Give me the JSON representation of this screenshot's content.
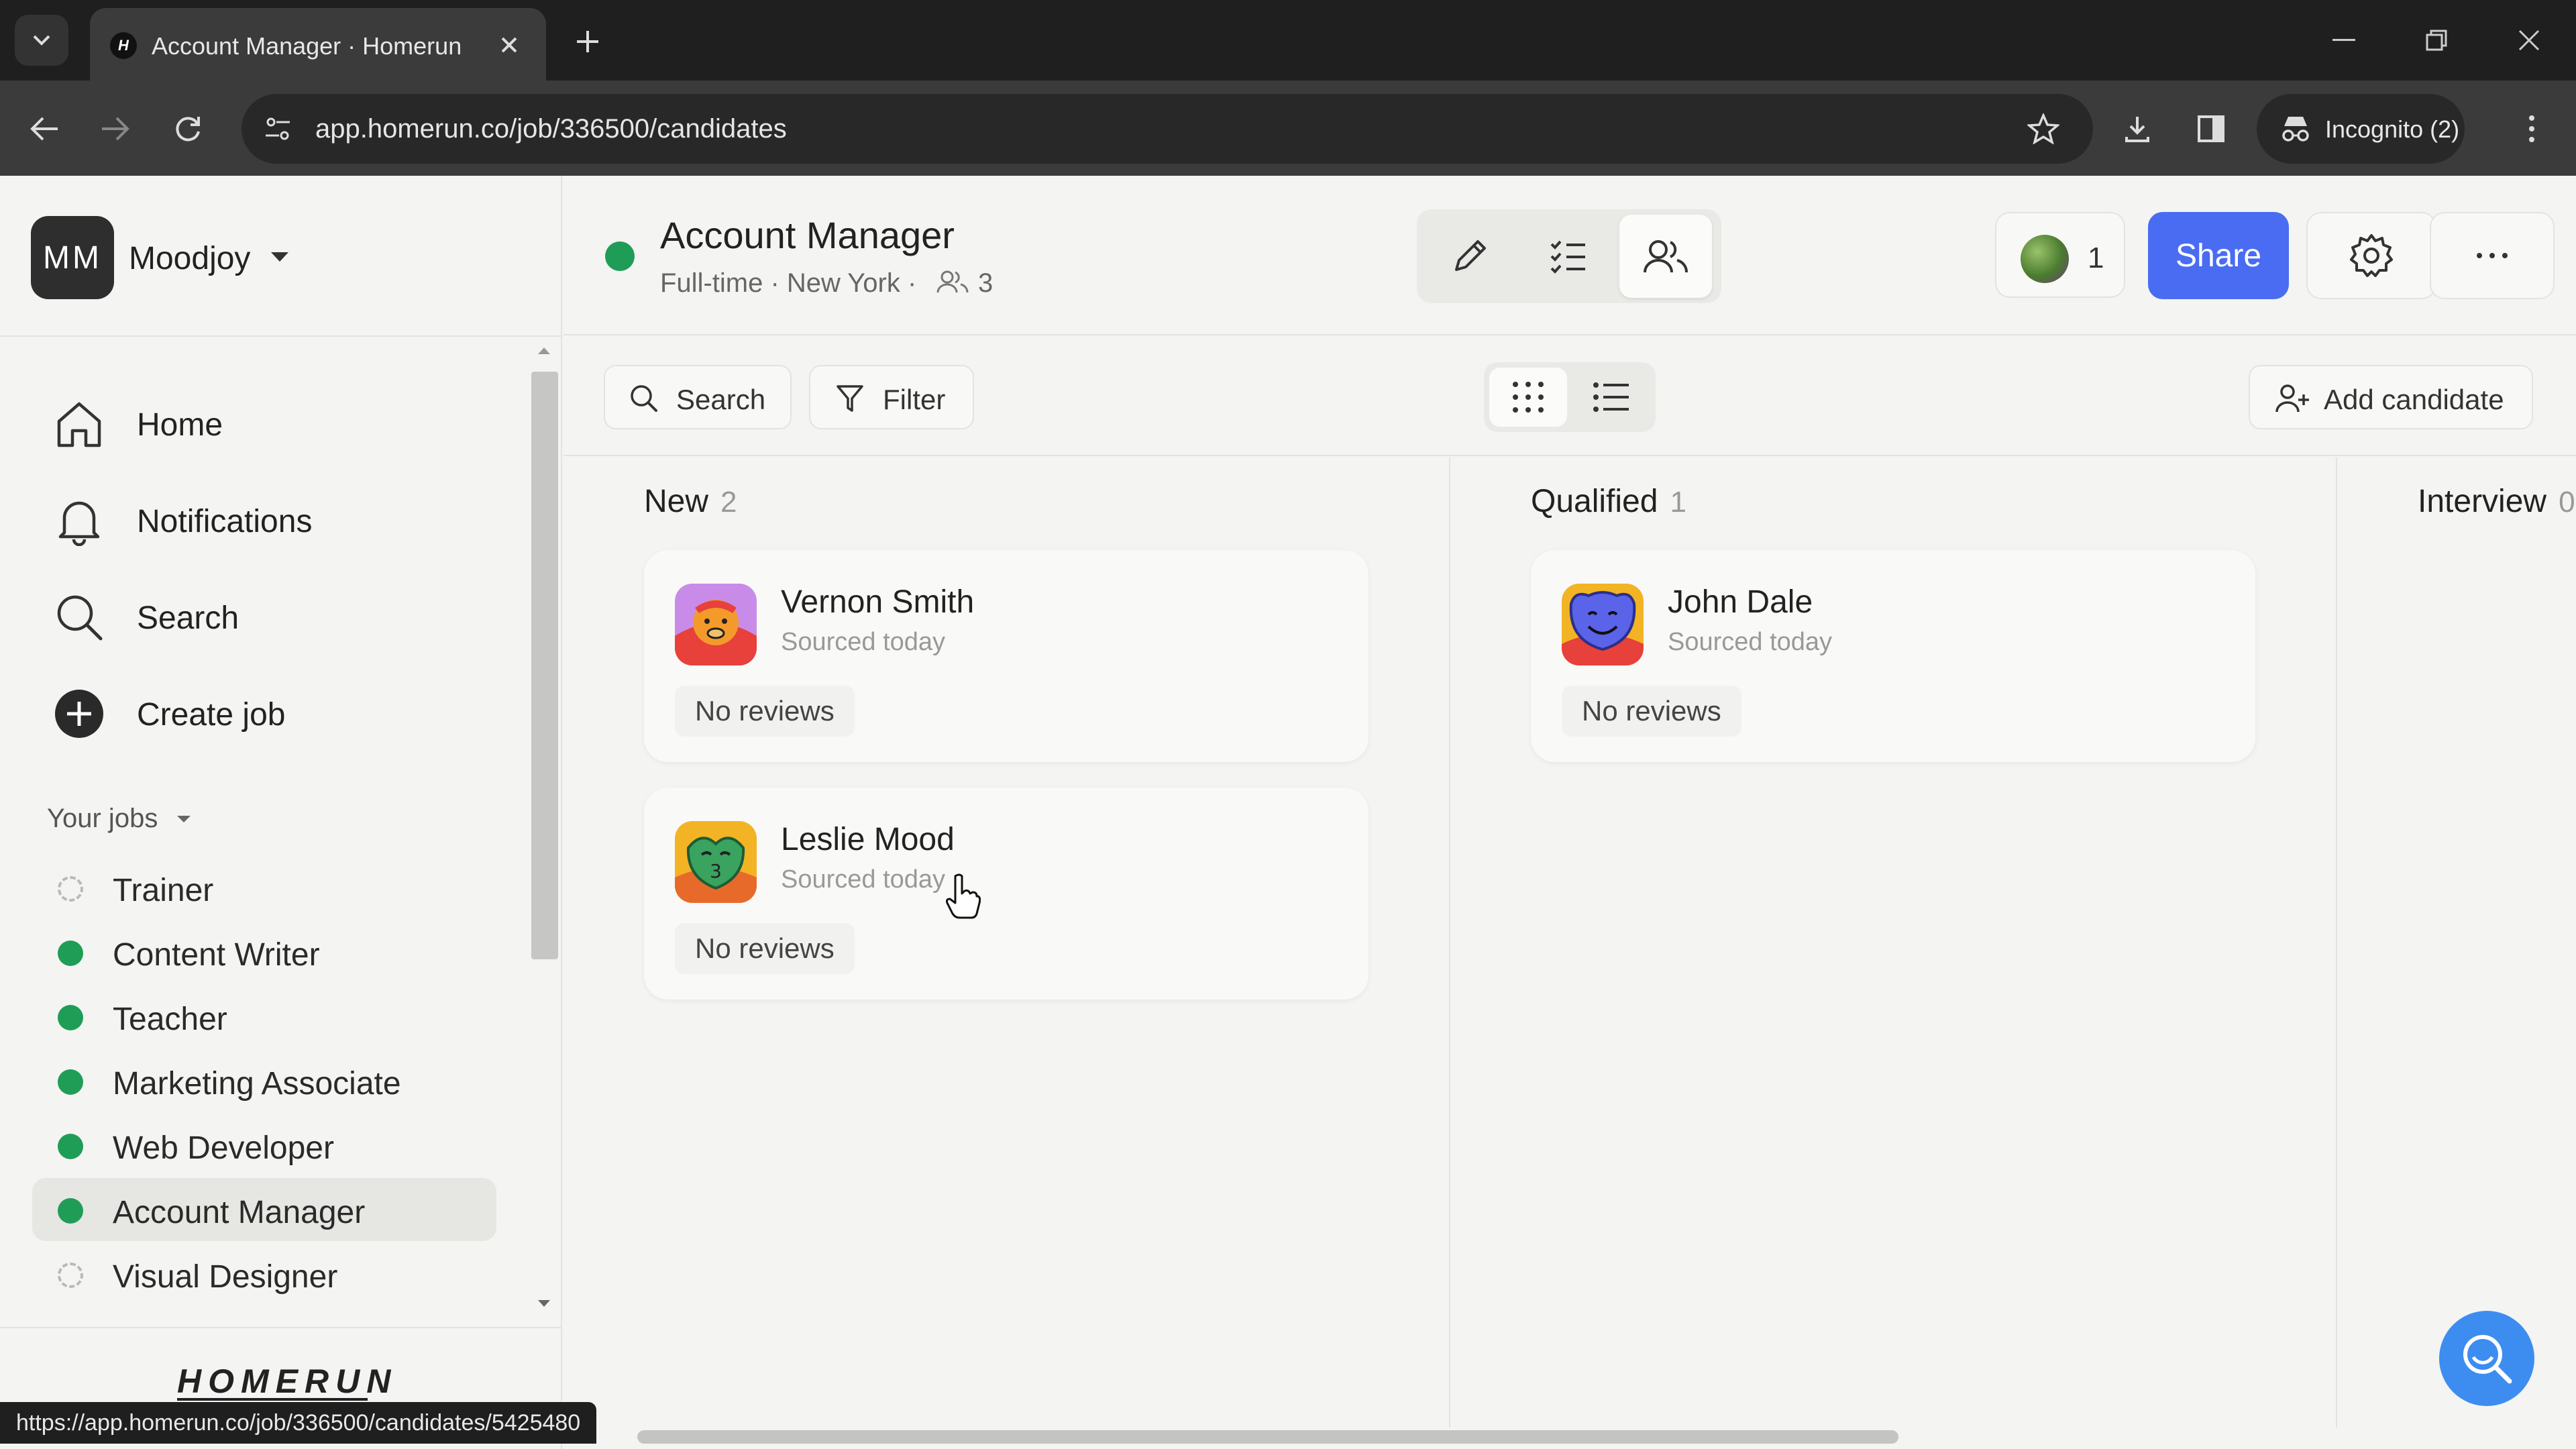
{
  "browser": {
    "tab_title": "Account Manager · Homerun",
    "favicon_letter": "H",
    "url": "app.homerun.co/job/336500/candidates",
    "incognito_label": "Incognito (2)",
    "status_url": "https://app.homerun.co/job/336500/candidates/5425480"
  },
  "sidebar": {
    "org_initials": "MM",
    "org_name": "Moodjoy",
    "nav": [
      {
        "label": "Home",
        "icon": "home-icon"
      },
      {
        "label": "Notifications",
        "icon": "bell-icon"
      },
      {
        "label": "Search",
        "icon": "search-icon"
      },
      {
        "label": "Create job",
        "icon": "plus-circle-icon"
      }
    ],
    "your_jobs_label": "Your jobs",
    "jobs": [
      {
        "label": "Trainer",
        "status": "draft"
      },
      {
        "label": "Content Writer",
        "status": "active"
      },
      {
        "label": "Teacher",
        "status": "active"
      },
      {
        "label": "Marketing Associate",
        "status": "active"
      },
      {
        "label": "Web Developer",
        "status": "active"
      },
      {
        "label": "Account Manager",
        "status": "active",
        "selected": true
      },
      {
        "label": "Visual Designer",
        "status": "draft"
      }
    ],
    "logo_text": "HOMERUN"
  },
  "header": {
    "job_title": "Account Manager",
    "job_meta": "Full-time · New York ·",
    "candidate_count": "3",
    "team_count": "1",
    "share_label": "Share"
  },
  "toolbar": {
    "search_label": "Search",
    "filter_label": "Filter",
    "add_candidate_label": "Add candidate"
  },
  "board": {
    "columns": [
      {
        "title": "New",
        "count": "2",
        "cards": [
          {
            "name": "Vernon Smith",
            "sub": "Sourced today",
            "badge": "No reviews"
          },
          {
            "name": "Leslie Mood",
            "sub": "Sourced today",
            "badge": "No reviews"
          }
        ]
      },
      {
        "title": "Qualified",
        "count": "1",
        "cards": [
          {
            "name": "John Dale",
            "sub": "Sourced today",
            "badge": "No reviews"
          }
        ]
      },
      {
        "title": "Interview",
        "count": "0",
        "cards": []
      }
    ]
  },
  "colors": {
    "accent": "#4a6cf2",
    "active_status": "#1f9d57",
    "help_button": "#3d8df0"
  }
}
